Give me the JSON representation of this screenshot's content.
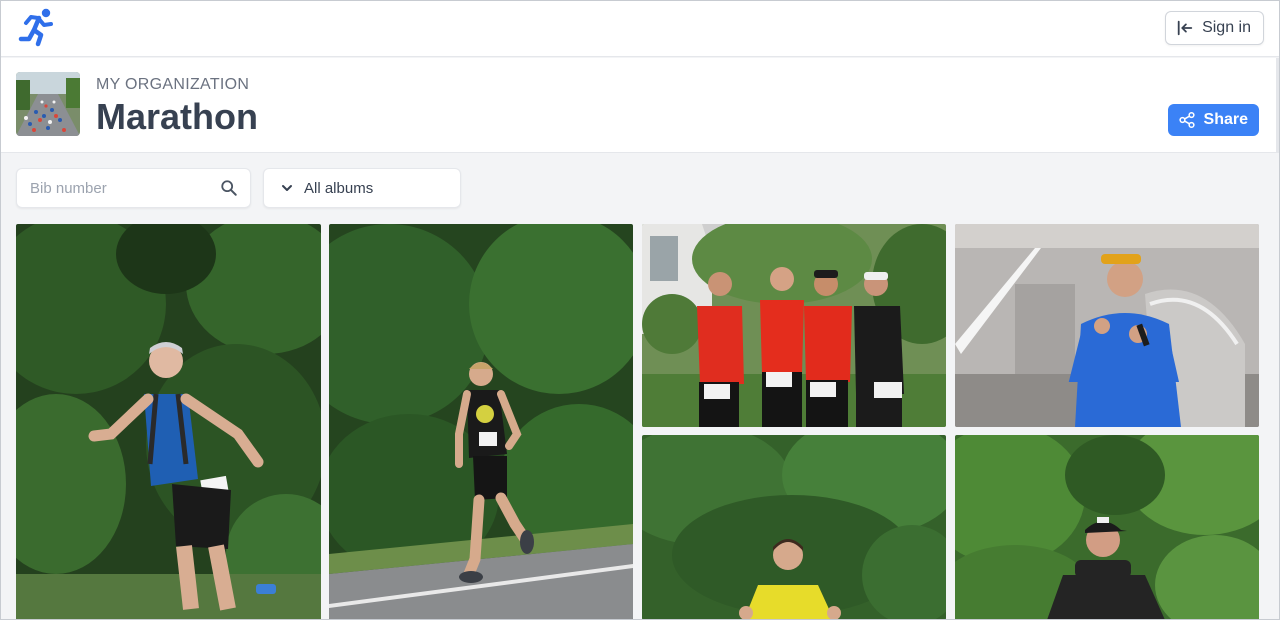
{
  "nav": {
    "logo_icon": "running-man-icon",
    "sign_in_label": "Sign in",
    "sign_in_icon": "arrow-left-bar-icon"
  },
  "header": {
    "organization": "MY ORGANIZATION",
    "title": "Marathon",
    "share_label": "Share",
    "share_icon": "share-nodes-icon"
  },
  "filters": {
    "search_placeholder": "Bib number",
    "search_value": "",
    "search_icon": "search-icon",
    "album_selected": "All albums",
    "album_icon": "chevron-down-icon"
  },
  "colors": {
    "accent": "#3b82f6",
    "text": "#374151",
    "muted": "#6b7280"
  },
  "photos": [
    {
      "id": "runner-blue-vest",
      "bib": ""
    },
    {
      "id": "runner-black-shirt",
      "bib": "30"
    },
    {
      "id": "group-red-shirts",
      "bibs": [
        "8029",
        "8020",
        "8033",
        "2125"
      ]
    },
    {
      "id": "announcer-microphone",
      "bib": ""
    },
    {
      "id": "runner-yellow-shirt",
      "bib": ""
    },
    {
      "id": "runner-cap-black",
      "bib": ""
    }
  ]
}
